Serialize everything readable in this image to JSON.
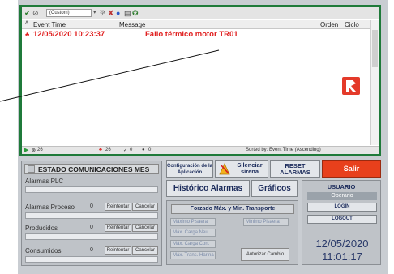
{
  "viewer": {
    "toolbar": {
      "filter": "(Custom)"
    },
    "columns": [
      "Event Time",
      "Message",
      "Orden",
      "Ciclo"
    ],
    "alarm": {
      "time": "12/05/2020  10:23:37",
      "message": "Fallo térmico motor TR01"
    },
    "status": {
      "count1": "26",
      "count2": "26",
      "count3": "0",
      "count4": "0",
      "sorted": "Sorted by: Event Time (Ascending)"
    }
  },
  "comms": {
    "title": "ESTADO COMUNICACIONES MES",
    "rows": [
      {
        "label": "Alarmas PLC",
        "count": ""
      },
      {
        "label": "Alarmas Proceso",
        "count": "0"
      },
      {
        "label": "Producidos",
        "count": "0"
      },
      {
        "label": "Consumidos",
        "count": "0"
      }
    ],
    "retry_label": "Reintentar",
    "cancel_label": "Cancelar"
  },
  "controls": {
    "config_label": "Configuración de la Aplicación",
    "silence_label": "Silenciar sirena",
    "reset_label": "RESET ALARMAS",
    "exit_label": "Salir",
    "history_label": "Histórico Alarmas",
    "charts_label": "Gráficos",
    "forced_title": "Forzado Máx. y Min. Transporte",
    "inputs": [
      "Máximo Pisaera",
      "Máx. Carga Neu.",
      "Máx. Carga Con.",
      "Máx. Trans. Harina",
      "Mínimo Pisaera"
    ],
    "authorize_label": "Autorizar Cambio"
  },
  "user": {
    "title": "USUARIO",
    "name": "Operario",
    "login_label": "LOGIN",
    "logout_label": "LOGOUT",
    "date": "12/05/2020",
    "time": "11:01:17"
  },
  "colors": {
    "alarm": "#e02020",
    "viewer_border": "#1f7a3a",
    "exit": "#e8401c"
  }
}
